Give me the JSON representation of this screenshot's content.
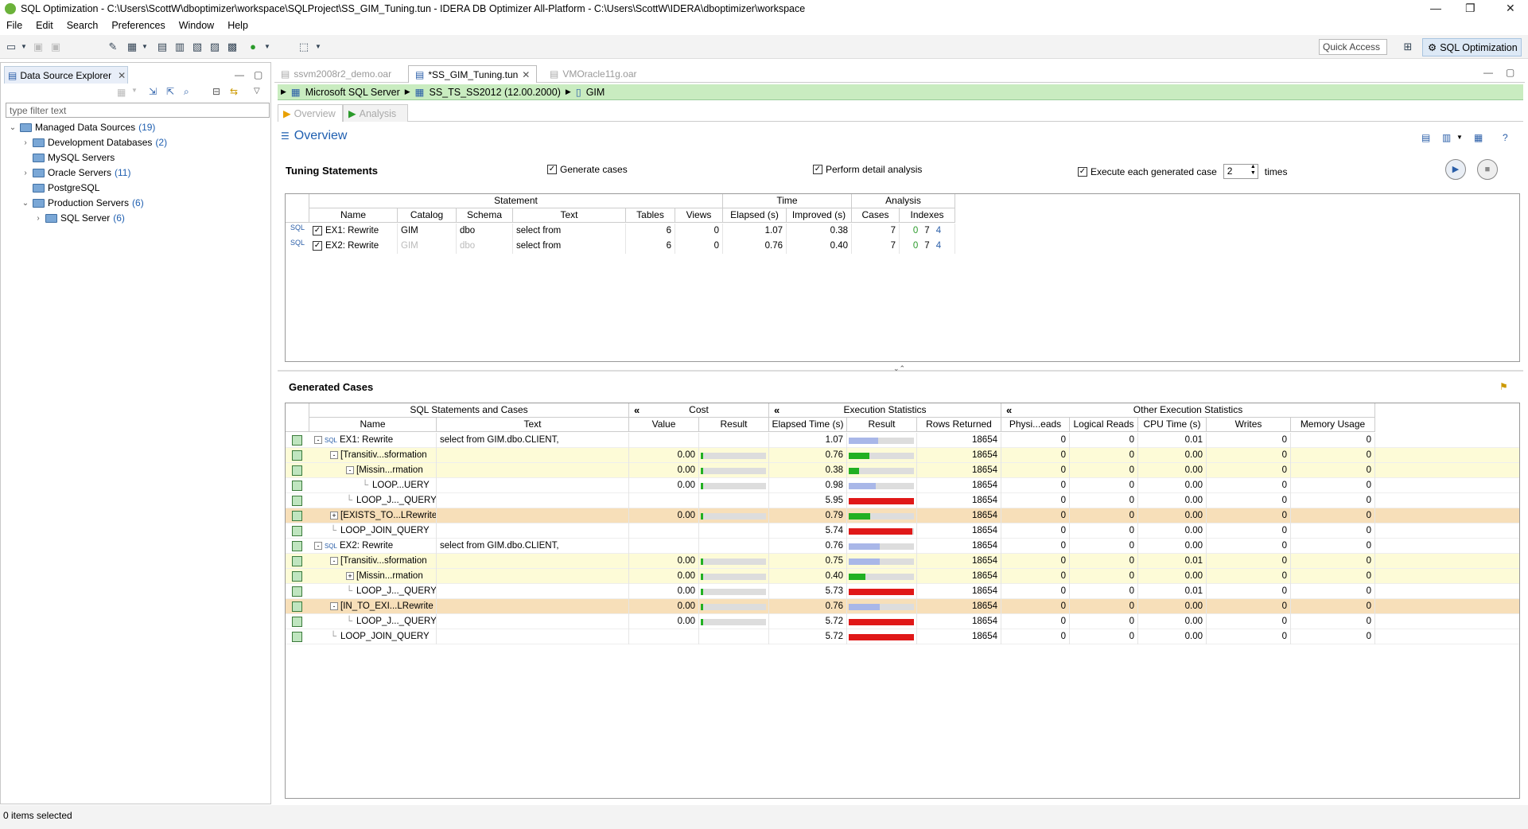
{
  "window": {
    "title": "SQL Optimization - C:\\Users\\ScottW\\dboptimizer\\workspace\\SQLProject\\SS_GIM_Tuning.tun - IDERA DB Optimizer All-Platform - C:\\Users\\ScottW\\IDERA\\dboptimizer\\workspace"
  },
  "menu": [
    "File",
    "Edit",
    "Search",
    "Preferences",
    "Window",
    "Help"
  ],
  "toolbar": {
    "quick_access": "Quick Access",
    "perspective": "SQL Optimization"
  },
  "explorer": {
    "tab_label": "Data Source Explorer",
    "filter_placeholder": "type filter text",
    "tree": [
      {
        "label": "Managed Data Sources",
        "count": "(19)",
        "level": 0,
        "twist": "v"
      },
      {
        "label": "Development Databases",
        "count": "(2)",
        "level": 1,
        "twist": ">"
      },
      {
        "label": "MySQL Servers",
        "count": "",
        "level": 1,
        "twist": ""
      },
      {
        "label": "Oracle Servers",
        "count": "(11)",
        "level": 1,
        "twist": ">"
      },
      {
        "label": "PostgreSQL",
        "count": "",
        "level": 1,
        "twist": ""
      },
      {
        "label": "Production Servers",
        "count": "(6)",
        "level": 1,
        "twist": "v"
      },
      {
        "label": "SQL Server",
        "count": "(6)",
        "level": 2,
        "twist": ">"
      }
    ]
  },
  "status": {
    "text": "0 items selected"
  },
  "editor": {
    "tabs": [
      {
        "label": "ssvm2008r2_demo.oar",
        "active": false
      },
      {
        "label": "*SS_GIM_Tuning.tun",
        "active": true
      },
      {
        "label": "VMOracle11g.oar",
        "active": false
      }
    ],
    "breadcrumb": [
      "Microsoft SQL Server",
      "SS_TS_SS2012 (12.00.2000)",
      "GIM"
    ],
    "subtabs": [
      "Overview",
      "Analysis"
    ],
    "overview_title": "Overview",
    "tuning": {
      "title": "Tuning Statements",
      "generate_cases": "Generate cases",
      "detail_analysis": "Perform detail analysis",
      "execute_each": "Execute each generated case",
      "times_value": "2",
      "times_label": "times",
      "group_headers": [
        "Statement",
        "Time",
        "Analysis"
      ],
      "columns": [
        "Name",
        "Catalog",
        "Schema",
        "Text",
        "Tables",
        "Views",
        "Elapsed (s)",
        "Improved (s)",
        "Cases",
        "Indexes"
      ],
      "rows": [
        {
          "name": "EX1: Rewrite",
          "catalog": "GIM",
          "schema": "dbo",
          "text": "select from",
          "tables": "6",
          "views": "0",
          "elapsed": "1.07",
          "improved": "0.38",
          "cases": "7",
          "idx": [
            "0",
            "7",
            "4"
          ],
          "dim": false
        },
        {
          "name": "EX2: Rewrite",
          "catalog": "GIM",
          "schema": "dbo",
          "text": "select from",
          "tables": "6",
          "views": "0",
          "elapsed": "0.76",
          "improved": "0.40",
          "cases": "7",
          "idx": [
            "0",
            "7",
            "4"
          ],
          "dim": true
        }
      ]
    },
    "generated": {
      "title": "Generated Cases",
      "group_headers": [
        "SQL Statements and Cases",
        "Cost",
        "Execution Statistics",
        "Other Execution Statistics"
      ],
      "collapse_glyph": "«",
      "columns": [
        "Name",
        "Text",
        "Value",
        "Result",
        "Elapsed Time (s)",
        "Result",
        "Rows Returned",
        "Physi...eads",
        "Logical Reads",
        "CPU Time (s)",
        "Writes",
        "Memory Usage"
      ],
      "rows": [
        {
          "name": "EX1: Rewrite",
          "level": 0,
          "exp": "-",
          "sql": true,
          "text": "select from GIM.dbo.CLIENT,",
          "cost": "",
          "costbar": 0,
          "elapsed": "1.07",
          "ebar": 0.45,
          "ecolor": "#a9b7e8",
          "rows": "18654",
          "phys": "0",
          "logical": "0",
          "cpu": "0.01",
          "writes": "0",
          "mem": "0",
          "bg": "#ffffff"
        },
        {
          "name": "[Transitiv...sformation",
          "level": 1,
          "exp": "-",
          "sql": false,
          "text": "",
          "cost": "0.00",
          "costbar": 1,
          "elapsed": "0.76",
          "ebar": 0.32,
          "ecolor": "#22b022",
          "rows": "18654",
          "phys": "0",
          "logical": "0",
          "cpu": "0.00",
          "writes": "0",
          "mem": "0",
          "bg": "#fdfbd7"
        },
        {
          "name": "[Missin...rmation",
          "level": 2,
          "exp": "-",
          "sql": false,
          "text": "",
          "cost": "0.00",
          "costbar": 1,
          "elapsed": "0.38",
          "ebar": 0.16,
          "ecolor": "#22b022",
          "rows": "18654",
          "phys": "0",
          "logical": "0",
          "cpu": "0.00",
          "writes": "0",
          "mem": "0",
          "bg": "#fdfbd7"
        },
        {
          "name": "LOOP...UERY",
          "level": 3,
          "exp": "",
          "sql": false,
          "text": "",
          "cost": "0.00",
          "costbar": 1,
          "elapsed": "0.98",
          "ebar": 0.42,
          "ecolor": "#a9b7e8",
          "rows": "18654",
          "phys": "0",
          "logical": "0",
          "cpu": "0.00",
          "writes": "0",
          "mem": "0",
          "bg": "#ffffff"
        },
        {
          "name": "LOOP_J..._QUERY",
          "level": 2,
          "exp": "",
          "sql": false,
          "text": "",
          "cost": "",
          "costbar": 0,
          "elapsed": "5.95",
          "ebar": 1.0,
          "ecolor": "#e01818",
          "rows": "18654",
          "phys": "0",
          "logical": "0",
          "cpu": "0.00",
          "writes": "0",
          "mem": "0",
          "bg": "#ffffff"
        },
        {
          "name": "[EXISTS_TO...LRewrite",
          "level": 1,
          "exp": "+",
          "sql": false,
          "text": "",
          "cost": "0.00",
          "costbar": 1,
          "elapsed": "0.79",
          "ebar": 0.33,
          "ecolor": "#22b022",
          "rows": "18654",
          "phys": "0",
          "logical": "0",
          "cpu": "0.00",
          "writes": "0",
          "mem": "0",
          "bg": "#f7dfb9"
        },
        {
          "name": "LOOP_JOIN_QUERY",
          "level": 1,
          "exp": "",
          "sql": false,
          "text": "",
          "cost": "",
          "costbar": 0,
          "elapsed": "5.74",
          "ebar": 0.97,
          "ecolor": "#e01818",
          "rows": "18654",
          "phys": "0",
          "logical": "0",
          "cpu": "0.00",
          "writes": "0",
          "mem": "0",
          "bg": "#ffffff"
        },
        {
          "name": "EX2: Rewrite",
          "level": 0,
          "exp": "-",
          "sql": true,
          "text": "select from GIM.dbo.CLIENT,",
          "cost": "",
          "costbar": 0,
          "elapsed": "0.76",
          "ebar": 0.48,
          "ecolor": "#a9b7e8",
          "rows": "18654",
          "phys": "0",
          "logical": "0",
          "cpu": "0.00",
          "writes": "0",
          "mem": "0",
          "bg": "#ffffff"
        },
        {
          "name": "[Transitiv...sformation",
          "level": 1,
          "exp": "-",
          "sql": false,
          "text": "",
          "cost": "0.00",
          "costbar": 1,
          "elapsed": "0.75",
          "ebar": 0.47,
          "ecolor": "#a9b7e8",
          "rows": "18654",
          "phys": "0",
          "logical": "0",
          "cpu": "0.01",
          "writes": "0",
          "mem": "0",
          "bg": "#fdfbd7"
        },
        {
          "name": "[Missin...rmation",
          "level": 2,
          "exp": "+",
          "sql": false,
          "text": "",
          "cost": "0.00",
          "costbar": 1,
          "elapsed": "0.40",
          "ebar": 0.26,
          "ecolor": "#22b022",
          "rows": "18654",
          "phys": "0",
          "logical": "0",
          "cpu": "0.00",
          "writes": "0",
          "mem": "0",
          "bg": "#fdfbd7"
        },
        {
          "name": "LOOP_J..._QUERY",
          "level": 2,
          "exp": "",
          "sql": false,
          "text": "",
          "cost": "0.00",
          "costbar": 1,
          "elapsed": "5.73",
          "ebar": 1.0,
          "ecolor": "#e01818",
          "rows": "18654",
          "phys": "0",
          "logical": "0",
          "cpu": "0.01",
          "writes": "0",
          "mem": "0",
          "bg": "#ffffff"
        },
        {
          "name": "[IN_TO_EXI...LRewrite",
          "level": 1,
          "exp": "-",
          "sql": false,
          "text": "",
          "cost": "0.00",
          "costbar": 1,
          "elapsed": "0.76",
          "ebar": 0.48,
          "ecolor": "#a9b7e8",
          "rows": "18654",
          "phys": "0",
          "logical": "0",
          "cpu": "0.00",
          "writes": "0",
          "mem": "0",
          "bg": "#f7dfb9"
        },
        {
          "name": "LOOP_J..._QUERY",
          "level": 2,
          "exp": "",
          "sql": false,
          "text": "",
          "cost": "0.00",
          "costbar": 1,
          "elapsed": "5.72",
          "ebar": 1.0,
          "ecolor": "#e01818",
          "rows": "18654",
          "phys": "0",
          "logical": "0",
          "cpu": "0.00",
          "writes": "0",
          "mem": "0",
          "bg": "#ffffff"
        },
        {
          "name": "LOOP_JOIN_QUERY",
          "level": 1,
          "exp": "",
          "sql": false,
          "text": "",
          "cost": "",
          "costbar": 0,
          "elapsed": "5.72",
          "ebar": 1.0,
          "ecolor": "#e01818",
          "rows": "18654",
          "phys": "0",
          "logical": "0",
          "cpu": "0.00",
          "writes": "0",
          "mem": "0",
          "bg": "#ffffff"
        }
      ]
    }
  }
}
